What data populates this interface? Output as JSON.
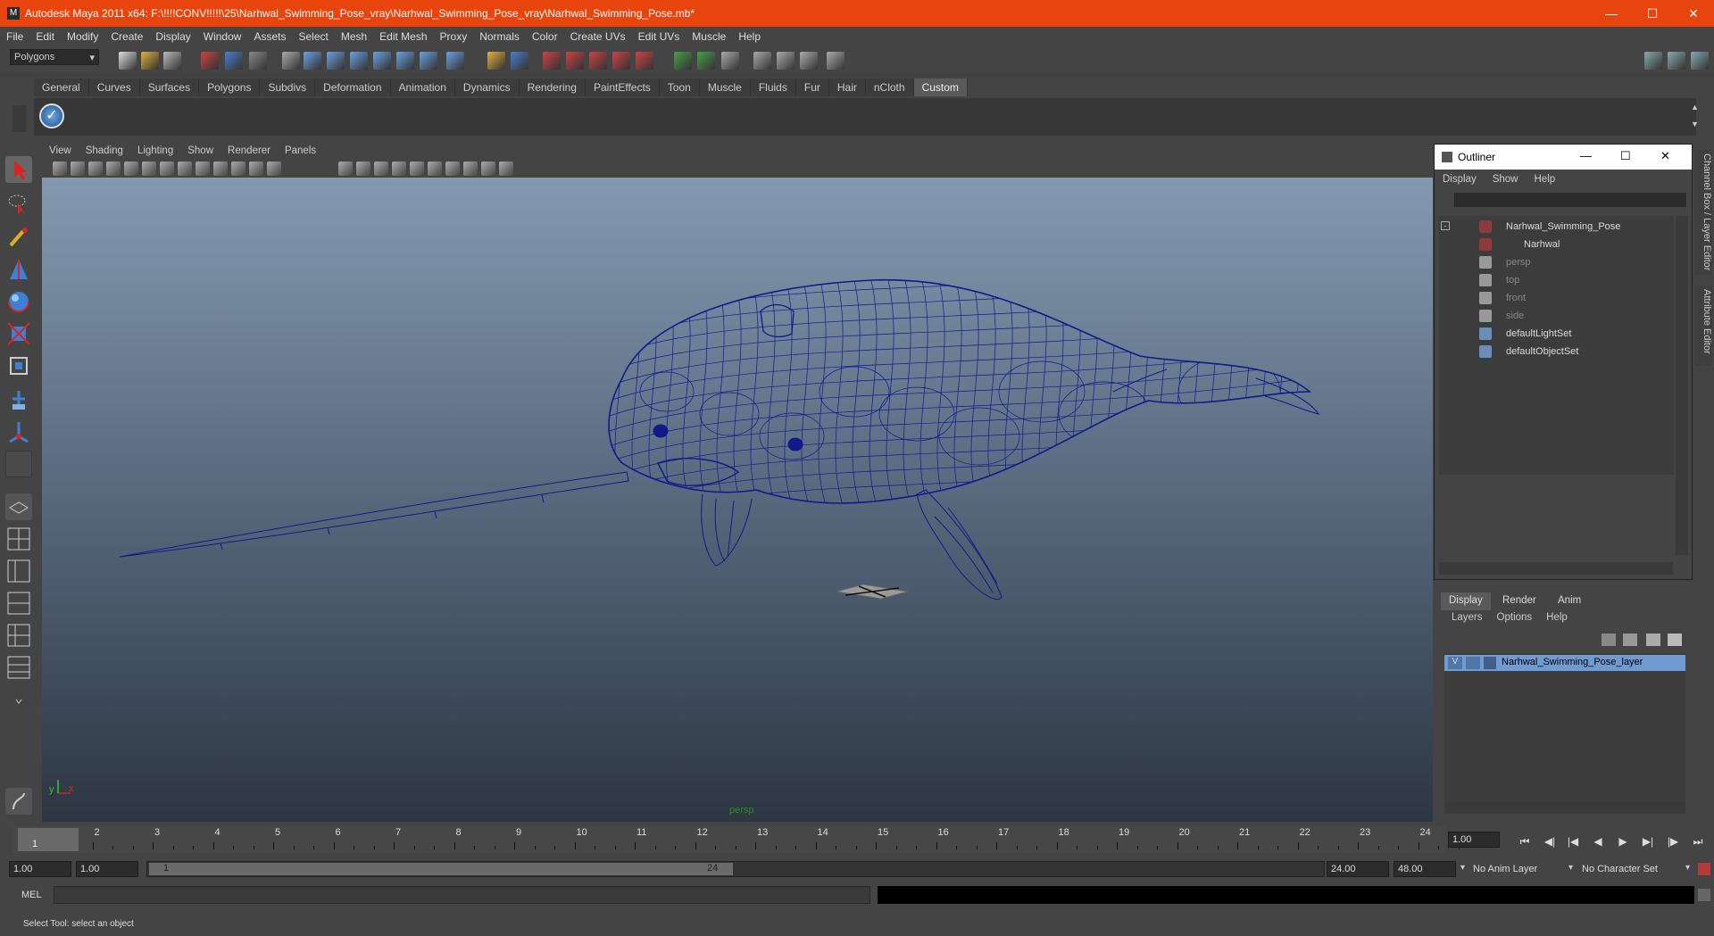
{
  "window": {
    "title": "Autodesk Maya 2011 x64: F:\\!!!!CONV!!!!!\\25\\Narhwal_Swimming_Pose_vray\\Narhwal_Swimming_Pose_vray\\Narhwal_Swimming_Pose.mb*"
  },
  "menu": [
    "File",
    "Edit",
    "Modify",
    "Create",
    "Display",
    "Window",
    "Assets",
    "Select",
    "Mesh",
    "Edit Mesh",
    "Proxy",
    "Normals",
    "Color",
    "Create UVs",
    "Edit UVs",
    "Muscle",
    "Help"
  ],
  "status": {
    "mode": "Polygons"
  },
  "shelf_tabs": [
    "General",
    "Curves",
    "Surfaces",
    "Polygons",
    "Subdivs",
    "Deformation",
    "Animation",
    "Dynamics",
    "Rendering",
    "PaintEffects",
    "Toon",
    "Muscle",
    "Fluids",
    "Fur",
    "Hair",
    "nCloth",
    "Custom"
  ],
  "shelf_active": "Custom",
  "viewport": {
    "menu": [
      "View",
      "Shading",
      "Lighting",
      "Show",
      "Renderer",
      "Panels"
    ],
    "camera_label": "persp"
  },
  "outliner": {
    "title": "Outliner",
    "menu": [
      "Display",
      "Show",
      "Help"
    ],
    "items": [
      {
        "label": "Narhwal_Swimming_Pose",
        "dim": false
      },
      {
        "label": "Narhwal",
        "dim": false
      },
      {
        "label": "persp",
        "dim": true
      },
      {
        "label": "top",
        "dim": true
      },
      {
        "label": "front",
        "dim": true
      },
      {
        "label": "side",
        "dim": true
      },
      {
        "label": "defaultLightSet",
        "dim": false
      },
      {
        "label": "defaultObjectSet",
        "dim": false
      }
    ]
  },
  "layers": {
    "tabs": [
      "Display",
      "Render",
      "Anim"
    ],
    "menu": [
      "Layers",
      "Options",
      "Help"
    ],
    "layer_visible": "V",
    "layer_name": "Narhwal_Swimming_Pose_layer"
  },
  "side_tabs": [
    "Channel Box / Layer Editor",
    "Attribute Editor"
  ],
  "timeline": {
    "frames": [
      "1",
      "2",
      "3",
      "4",
      "5",
      "6",
      "7",
      "8",
      "9",
      "10",
      "11",
      "12",
      "13",
      "14",
      "15",
      "16",
      "17",
      "18",
      "19",
      "20",
      "21",
      "22",
      "23",
      "24"
    ],
    "current": "1",
    "current_field": "1.00"
  },
  "range": {
    "start": "1.00",
    "playback_start": "1.00",
    "slider_start": "1",
    "slider_end": "24",
    "playback_end": "24.00",
    "end": "48.00",
    "anim_layer": "No Anim Layer",
    "char_set": "No Character Set"
  },
  "cmd": {
    "label": "MEL"
  },
  "help": {
    "text": "Select Tool: select an object"
  },
  "colors": {
    "titlebar": "#e8440e",
    "wire": "#101a8a",
    "selected_layer": "#6f9bd1"
  }
}
